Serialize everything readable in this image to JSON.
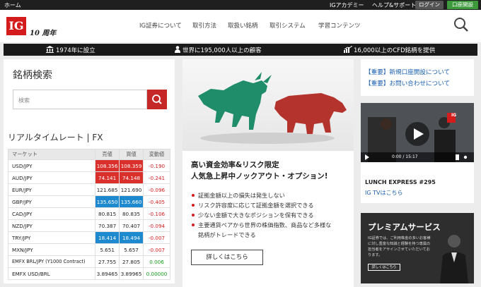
{
  "topbar": {
    "home": "ホーム",
    "academy": "IGアカデミー",
    "help": "ヘルプ&サポート",
    "login": "ログイン",
    "open_account": "口座開設"
  },
  "header": {
    "logo": "IG",
    "anniversary": "10 周年",
    "nav": [
      "IG証券について",
      "取引方法",
      "取扱い銘柄",
      "取引システム",
      "学習コンテンツ"
    ]
  },
  "stats": {
    "founded": "1974年に設立",
    "clients": "世界に195,000人以上の顧客",
    "products": "16,000以上のCFD銘柄を提供"
  },
  "search": {
    "title": "銘柄検索",
    "placeholder": "検索"
  },
  "rates": {
    "title": "リアルタイムレート | FX",
    "headers": [
      "マーケット",
      "売値",
      "買値",
      "変動値"
    ],
    "rows": [
      {
        "pair": "USD/JPY",
        "sell": "108.356",
        "buy": "108.359",
        "change": "-0.190"
      },
      {
        "pair": "AUD/JPY",
        "sell": "74.141",
        "buy": "74.148",
        "change": "-0.241"
      },
      {
        "pair": "EUR/JPY",
        "sell": "121.685",
        "buy": "121.690",
        "change": "-0.096"
      },
      {
        "pair": "GBP/JPY",
        "sell": "135.650",
        "buy": "135.660",
        "change": "-0.405"
      },
      {
        "pair": "CAD/JPY",
        "sell": "80.815",
        "buy": "80.835",
        "change": "-0.106"
      },
      {
        "pair": "NZD/JPY",
        "sell": "70.387",
        "buy": "70.407",
        "change": "-0.094"
      },
      {
        "pair": "TRY/JPY",
        "sell": "18.414",
        "buy": "18.494",
        "change": "-0.007"
      },
      {
        "pair": "MXN/JPY",
        "sell": "5.651",
        "buy": "5.657",
        "change": "-0.007"
      },
      {
        "pair": "EMFX BRL/JPY (Y1000 Contract)",
        "sell": "27.755",
        "buy": "27.805",
        "change": "0.006"
      },
      {
        "pair": "EMFX USD/BRL",
        "sell": "3.89465",
        "buy": "3.89965",
        "change": "0.00000"
      }
    ]
  },
  "promo": {
    "headline_1": "高い資金効率&リスク限定",
    "headline_2": "人気急上昇中ノックアウト・オプション!",
    "bullets": [
      "証拠金額以上の損失は発生しない",
      "リスク許容度に応じて証拠金額を選択できる",
      "少ない金額で大きなポジションを保有できる",
      "主要通貨ペアから世界の株価指数、商品など多様な",
      "銘柄がトレードできる"
    ],
    "more": "詳しくはこちら"
  },
  "notices": {
    "n1": "【重要】新規口座開設について",
    "n2": "【重要】お問い合わせについて"
  },
  "video": {
    "time": "0:00 / 15:17",
    "title": "LUNCH EXPRESS #295",
    "link": "IG TVはこちら",
    "badge": "IG"
  },
  "premium": {
    "title": "プレミアムサービス",
    "desc": "IG証券では、ご利用株金の多いお客様に対し豊富な知識と経験を持つ専属の担当者をアサインさせていただいております。",
    "button": "詳しくはこちら"
  }
}
